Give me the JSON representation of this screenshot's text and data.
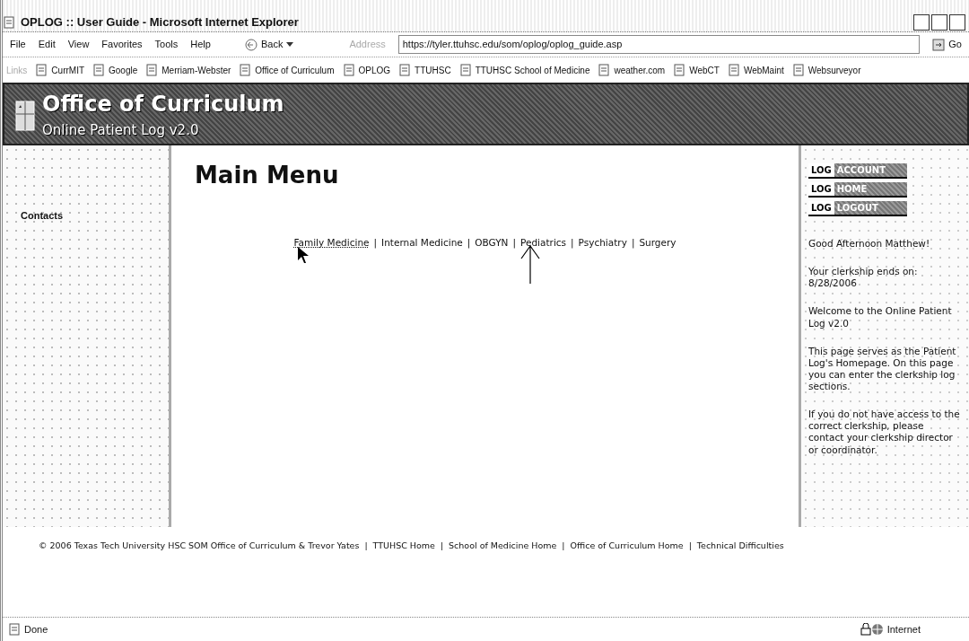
{
  "window": {
    "title": "OPLOG :: User Guide - Microsoft Internet Explorer"
  },
  "menu": [
    "File",
    "Edit",
    "View",
    "Favorites",
    "Tools",
    "Help"
  ],
  "toolbar": {
    "back": "Back",
    "address_label": "Address",
    "address": "https://tyler.ttuhsc.edu/som/oplog/oplog_guide.asp",
    "go": "Go"
  },
  "links_bar": {
    "label": "Links",
    "items": [
      "CurrMIT",
      "Google",
      "Merriam-Webster",
      "Office of Curriculum",
      "OPLOG",
      "TTUHSC",
      "TTUHSC School of Medicine",
      "weather.com",
      "WebCT",
      "WebMaint",
      "Websurveyor"
    ]
  },
  "header": {
    "title": "Office of Curriculum",
    "subtitle": "Online Patient Log v2.0"
  },
  "sidebar": {
    "items": [
      "Contacts"
    ]
  },
  "main": {
    "heading": "Main Menu",
    "separator": "|",
    "clerkships": [
      {
        "label": "Family Medicine",
        "focused": true
      },
      {
        "label": "Internal Medicine",
        "focused": false
      },
      {
        "label": "OBGYN",
        "focused": false
      },
      {
        "label": "Pediatrics",
        "focused": false
      },
      {
        "label": "Psychiatry",
        "focused": false
      },
      {
        "label": "Surgery",
        "focused": false
      }
    ]
  },
  "right_panel": {
    "buttons": [
      {
        "prefix": "LOG",
        "label": "ACCOUNT"
      },
      {
        "prefix": "LOG",
        "label": "HOME"
      },
      {
        "prefix": "LOG",
        "label": "LOGOUT"
      }
    ],
    "paragraphs": [
      "Good Afternoon Matthew!",
      "Your clerkship ends on: 8/28/2006",
      "Welcome to the Online Patient Log v2.0",
      "This page serves as the Patient Log's Homepage. On this page you can enter the clerkship log sections.",
      "If you do not have access to the correct clerkship, please contact your clerkship director or coordinator."
    ]
  },
  "footer": {
    "copyright": "© 2006 Texas Tech University HSC SOM Office of Curriculum & Trevor Yates",
    "separator": "|",
    "links": [
      "TTUHSC Home",
      "School of Medicine Home",
      "Office of Curriculum Home",
      "Technical Difficulties"
    ]
  },
  "status_bar": {
    "text": "Done",
    "zone": "Internet"
  }
}
